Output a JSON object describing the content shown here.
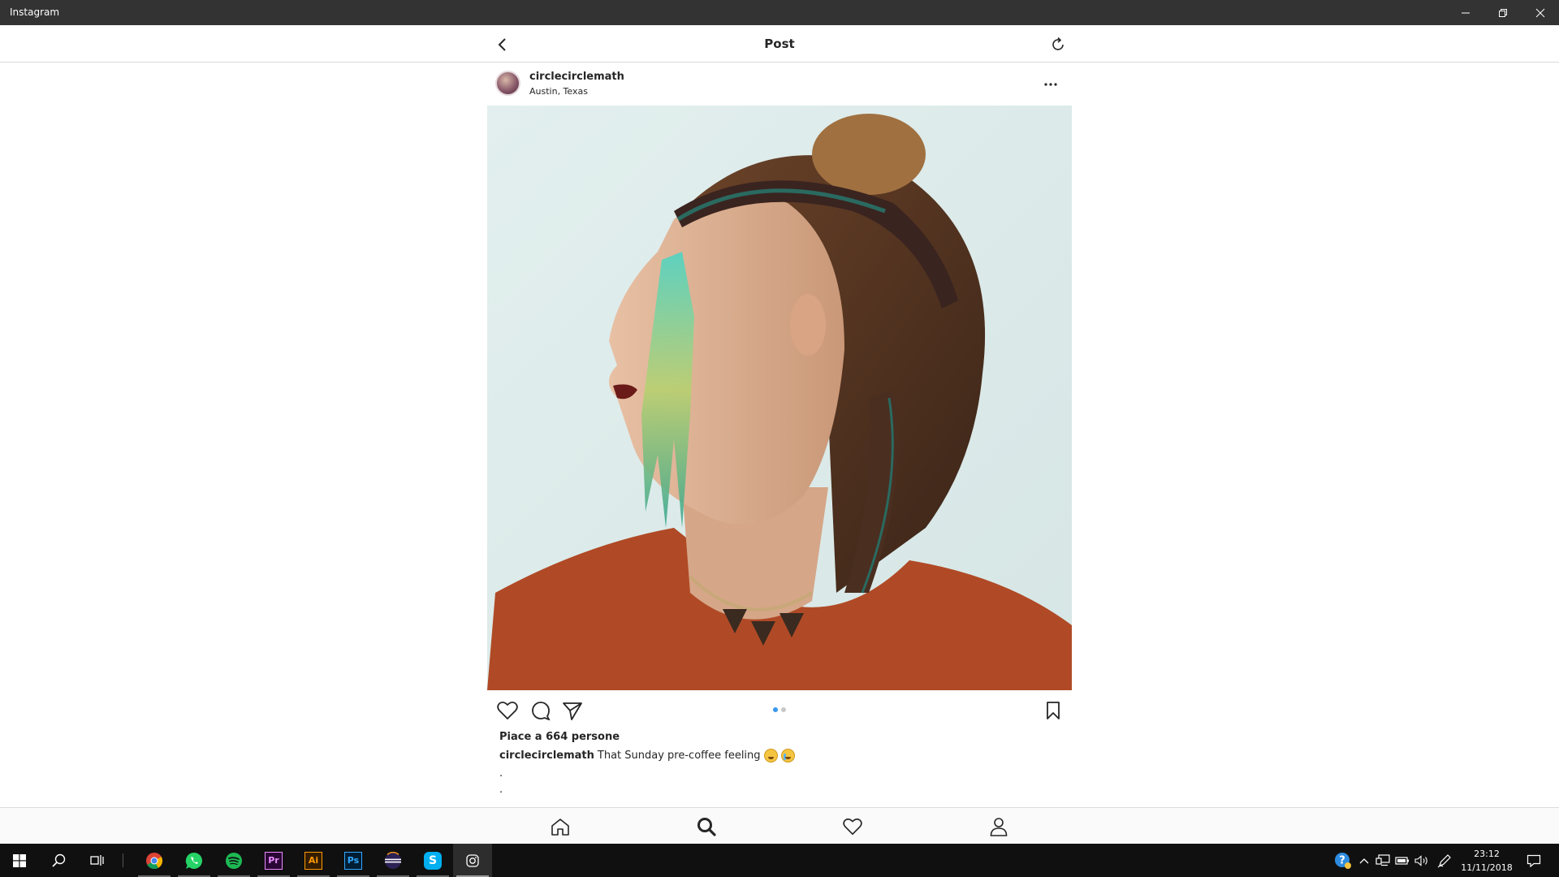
{
  "window": {
    "title": "Instagram"
  },
  "header": {
    "title": "Post"
  },
  "post": {
    "username": "circlecirclemath",
    "location": "Austin, Texas",
    "carousel": {
      "count": 2,
      "active_index": 0
    },
    "likes_text": "Piace a 664 persone",
    "caption_user": "circlecirclemath",
    "caption_text": "That Sunday pre-coffee feeling",
    "caption_lines": [
      ".",
      "."
    ]
  },
  "bottom_nav": [
    "home-icon",
    "search-icon",
    "heart-icon",
    "profile-icon"
  ],
  "taskbar": {
    "apps": [
      "chrome",
      "whatsapp",
      "spotify",
      "premiere",
      "illustrator",
      "photoshop",
      "eclipse",
      "skype",
      "instagram"
    ],
    "premiere_label": "Pr",
    "illustrator_label": "Ai",
    "photoshop_label": "Ps",
    "skype_label": "S",
    "time": "23:12",
    "date": "11/11/2018"
  },
  "colors": {
    "accent": "#3897f0",
    "titlebar": "#333333",
    "taskbar": "#101010"
  }
}
